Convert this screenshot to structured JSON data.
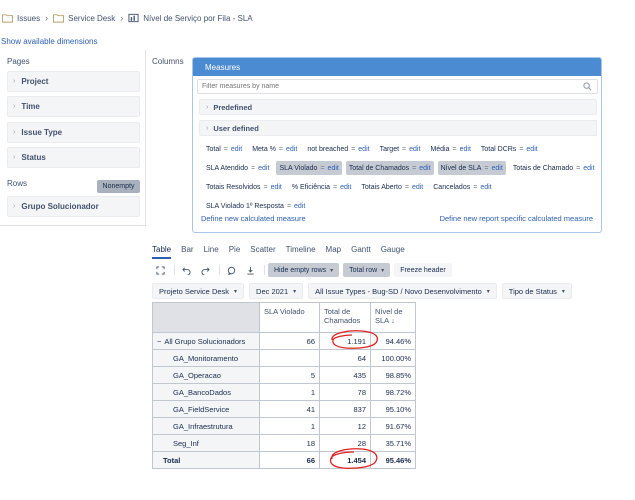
{
  "breadcrumb": {
    "items": [
      "Issues",
      "Service Desk",
      "Nível de Serviço por Fila - SLA"
    ]
  },
  "show_dims_label": "Show available dimensions",
  "pages": {
    "label": "Pages",
    "dimensions": [
      "Project",
      "Time",
      "Issue Type",
      "Status"
    ]
  },
  "rows": {
    "label": "Rows",
    "nonempty_label": "Nonempty",
    "dimensions": [
      "Grupo Solucionador"
    ]
  },
  "columns_label": "Columns",
  "measures": {
    "title": "Measures",
    "filter_placeholder": "Filter measures by name",
    "groups": [
      "Predefined",
      "User defined"
    ],
    "rows": [
      [
        {
          "name": "Total",
          "edit": "edit",
          "selected": false
        },
        {
          "name": "Meta %",
          "edit": "edit",
          "selected": false
        },
        {
          "name": "not breached",
          "edit": "edit",
          "selected": false
        },
        {
          "name": "Target",
          "edit": "edit",
          "selected": false
        },
        {
          "name": "Média",
          "edit": "edit",
          "selected": false
        },
        {
          "name": "Total DCRs",
          "edit": "edit",
          "selected": false
        }
      ],
      [
        {
          "name": "SLA Atendido",
          "edit": "edit",
          "selected": false
        },
        {
          "name": "SLA Violado",
          "edit": "edit",
          "selected": true
        },
        {
          "name": "Total de Chamados",
          "edit": "edit",
          "selected": true
        },
        {
          "name": "Nível de SLA",
          "edit": "edit",
          "selected": true
        },
        {
          "name": "Totais de Chamado",
          "edit": "edit",
          "selected": false
        }
      ],
      [
        {
          "name": "Totais Resolvidos",
          "edit": "edit",
          "selected": false
        },
        {
          "name": "% Eficiência",
          "edit": "edit",
          "selected": false
        },
        {
          "name": "Totais Aberto",
          "edit": "edit",
          "selected": false
        },
        {
          "name": "Cancelados",
          "edit": "edit",
          "selected": false
        }
      ],
      [
        {
          "name": "SLA Violado 1º Resposta",
          "edit": "edit",
          "selected": false
        }
      ]
    ],
    "define_new": "Define new calculated measure",
    "define_new_report": "Define new report specific calculated measure"
  },
  "view_tabs": [
    "Table",
    "Bar",
    "Line",
    "Pie",
    "Scatter",
    "Timeline",
    "Map",
    "Gantt",
    "Gauge"
  ],
  "active_tab": "Table",
  "toolbar": {
    "hide_empty": "Hide empty rows",
    "total_row": "Total row",
    "freeze_header": "Freeze header"
  },
  "filters": [
    "Projeto Service Desk",
    "Dec 2021",
    "All Issue Types - Bug-SD / Novo Desenvolvimento",
    "Tipo de Status"
  ],
  "table": {
    "columns": [
      "SLA Violado",
      "Total de Chamados",
      "Nível de SLA"
    ],
    "rows": [
      {
        "label": "All Grupo Solucionadors",
        "prefix": "−",
        "values": [
          "66",
          "1.191",
          "94.46%"
        ]
      },
      {
        "label": "GA_Monitoramento",
        "prefix": "",
        "values": [
          "",
          "64",
          "100.00%"
        ]
      },
      {
        "label": "GA_Operacao",
        "prefix": "",
        "values": [
          "5",
          "435",
          "98.85%"
        ]
      },
      {
        "label": "GA_BancoDados",
        "prefix": "",
        "values": [
          "1",
          "78",
          "98.72%"
        ]
      },
      {
        "label": "GA_FieldService",
        "prefix": "",
        "values": [
          "41",
          "837",
          "95.10%"
        ]
      },
      {
        "label": "GA_Infraestrutura",
        "prefix": "",
        "values": [
          "1",
          "12",
          "91.67%"
        ]
      },
      {
        "label": "Seg_Inf",
        "prefix": "",
        "values": [
          "18",
          "28",
          "35.71%"
        ]
      }
    ],
    "total": {
      "label": "Total",
      "values": [
        "66",
        "1.454",
        "95.46%"
      ]
    }
  },
  "colors": {
    "accent": "#4a8bd2",
    "annotation": "#e02020",
    "link": "#2d5fb4"
  }
}
